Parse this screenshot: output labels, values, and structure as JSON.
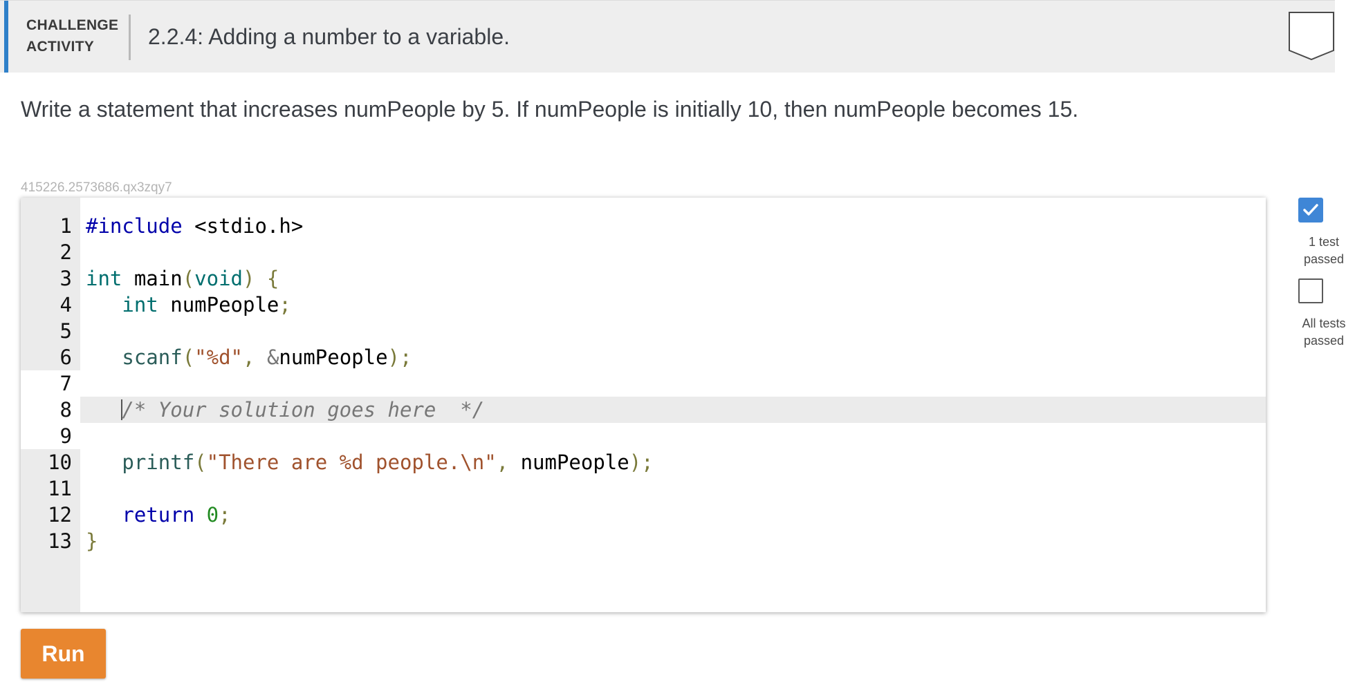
{
  "header": {
    "kind_line1": "CHALLENGE",
    "kind_line2": "ACTIVITY",
    "title": "2.2.4: Adding a number to a variable.",
    "accent_color": "#2f80c9"
  },
  "prompt": "Write a statement that increases numPeople by 5. If numPeople is initially 10, then numPeople becomes 15.",
  "code_id": "415226.2573686.qx3zqy7",
  "editor": {
    "line_numbers": [
      "1",
      "2",
      "3",
      "4",
      "5",
      "6",
      "7",
      "8",
      "9",
      "10",
      "11",
      "12",
      "13"
    ],
    "lines": {
      "l1": {
        "kw": "#include",
        "rest": " <stdio.h>"
      },
      "l3": {
        "type": "int",
        "name": " main",
        "open": "(",
        "param": "void",
        "close": ") {"
      },
      "l4": {
        "indent": "   ",
        "type": "int",
        "name": " numPeople",
        "semi": ";"
      },
      "l6": {
        "indent": "   ",
        "fn": "scanf",
        "open": "(",
        "str": "\"%d\"",
        "comma": ", ",
        "amp": "&",
        "var": "numPeople",
        "close": ");"
      },
      "l8": {
        "indent": "   ",
        "comment": "/* Your solution goes here  */"
      },
      "l10": {
        "indent": "   ",
        "fn": "printf",
        "open": "(",
        "str": "\"There are %d people.\\n\"",
        "comma": ", ",
        "var": "numPeople",
        "close": ");"
      },
      "l12": {
        "indent": "   ",
        "kw": "return",
        "sp": " ",
        "num": "0",
        "semi": ";"
      },
      "l13": {
        "brace": "}"
      }
    }
  },
  "tests": {
    "first_label": "1 test\npassed",
    "first_label_line1": "1 test",
    "first_label_line2": "passed",
    "first_state": "passed",
    "all_label_line1": "All tests",
    "all_label_line2": "passed",
    "all_state": "not passed",
    "passed_color": "#3f86d6"
  },
  "run_button": {
    "label": "Run",
    "color": "#e8862f"
  }
}
